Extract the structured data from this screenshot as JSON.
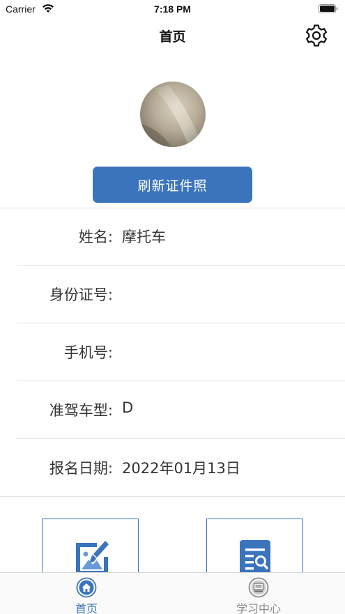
{
  "status_bar": {
    "carrier": "Carrier",
    "time": "7:18 PM"
  },
  "nav": {
    "title": "首页",
    "settings_icon": "gear-icon"
  },
  "profile": {
    "refresh_button_label": "刷新证件照"
  },
  "info": {
    "rows": [
      {
        "label": "姓名:",
        "value": "摩托车"
      },
      {
        "label": "身份证号:",
        "value": ""
      },
      {
        "label": "手机号:",
        "value": ""
      },
      {
        "label": "准驾车型:",
        "value": "D"
      },
      {
        "label": "报名日期:",
        "value": "2022年01月13日"
      }
    ]
  },
  "cards": {
    "left_icon": "paint-brush-image-icon",
    "right_icon": "document-search-icon"
  },
  "tab_bar": {
    "items": [
      {
        "label": "首页",
        "icon": "home-icon",
        "active": true
      },
      {
        "label": "学习中心",
        "icon": "monitor-icon",
        "active": false
      }
    ]
  },
  "colors": {
    "accent": "#3a74bd",
    "inactive_tab": "#8a8a8a",
    "divider": "#e3e3e3"
  }
}
